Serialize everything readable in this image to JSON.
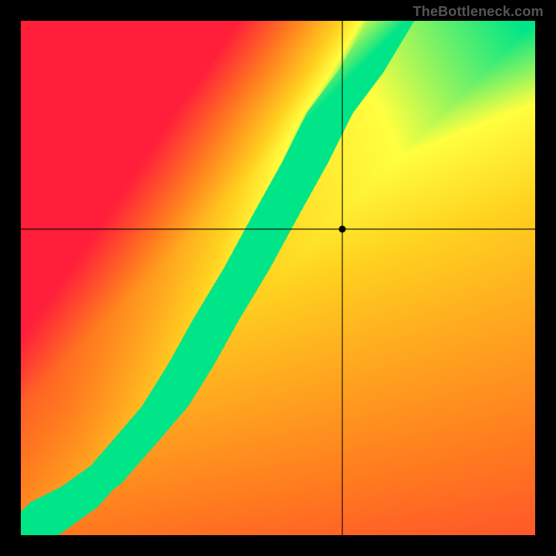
{
  "watermark": "TheBottleneck.com",
  "chart_data": {
    "type": "heatmap",
    "title": "",
    "xlabel": "",
    "ylabel": "",
    "xlim": [
      0,
      1
    ],
    "ylim": [
      0,
      1
    ],
    "legend": false,
    "color_scale": {
      "gradient": [
        "#ff1f3a",
        "#ff7a1f",
        "#ffd21f",
        "#ffff40",
        "#00e588"
      ],
      "mapping": "low=red orange yellow green=optimal"
    },
    "marker": {
      "x": 0.625,
      "y": 0.595
    },
    "curve": {
      "type": "optimal-band",
      "points": [
        [
          0.0,
          0.0
        ],
        [
          0.02,
          0.02
        ],
        [
          0.08,
          0.05
        ],
        [
          0.15,
          0.1
        ],
        [
          0.22,
          0.18
        ],
        [
          0.28,
          0.25
        ],
        [
          0.33,
          0.33
        ],
        [
          0.38,
          0.42
        ],
        [
          0.44,
          0.52
        ],
        [
          0.5,
          0.63
        ],
        [
          0.55,
          0.72
        ],
        [
          0.6,
          0.82
        ],
        [
          0.66,
          0.9
        ],
        [
          0.72,
          1.0
        ]
      ],
      "band_half_width": 0.045
    },
    "grid": [
      740,
      740
    ]
  }
}
